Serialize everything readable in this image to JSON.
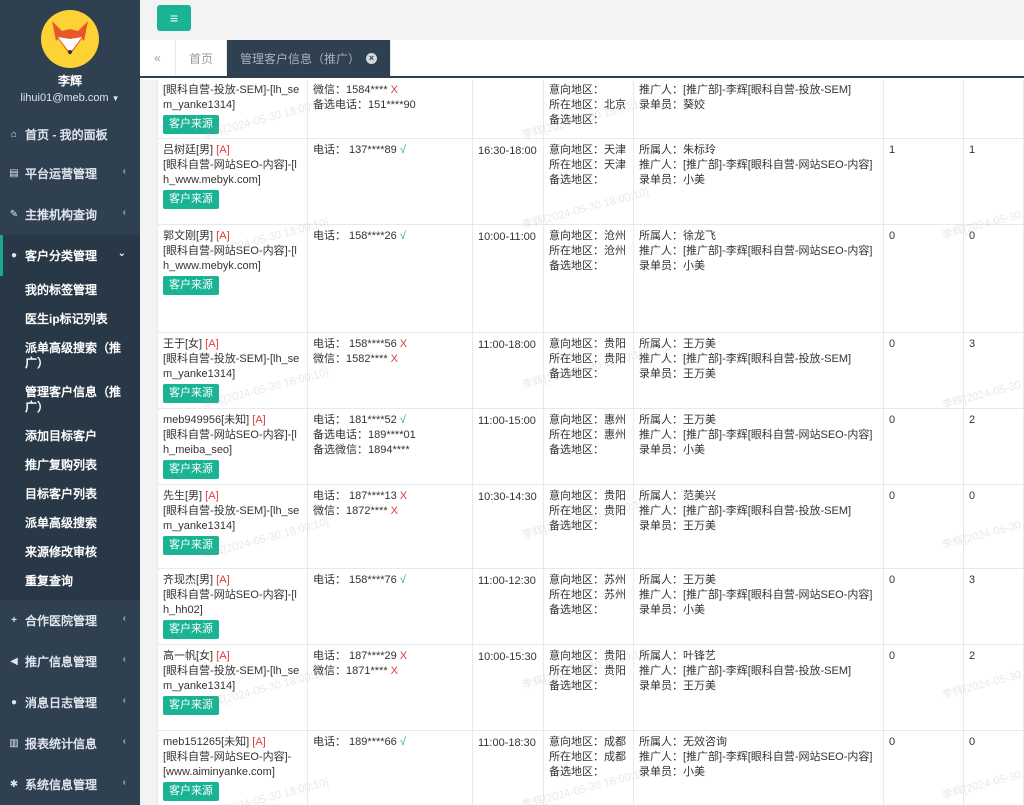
{
  "user": {
    "name": "李辉",
    "email": "lihui01@meb.com"
  },
  "nav": {
    "home": "首页 - 我的面板",
    "platform": "平台运营管理",
    "org": "主推机构查询",
    "customer": "客户分类管理",
    "sub": [
      "我的标签管理",
      "医生ip标记列表",
      "派单高级搜索（推广）",
      "管理客户信息（推广）",
      "添加目标客户",
      "推广复购列表",
      "目标客户列表",
      "派单高级搜索",
      "来源修改审核",
      "重复查询"
    ],
    "hospital": "合作医院管理",
    "promo": "推广信息管理",
    "msglog": "消息日志管理",
    "report": "报表统计信息",
    "system": "系统信息管理"
  },
  "tabs": {
    "home": "首页",
    "active": "管理客户信息（推广）"
  },
  "watermark_text": "李辉[2024-05-30 18:00:10]",
  "labels": {
    "source_btn": "客户来源",
    "intent": "意向地区：",
    "location": "所在地区：",
    "alt": "备选地区：",
    "owner": "所属人：",
    "promoter": "推广人：",
    "recorder": "录单员："
  },
  "rows": [
    {
      "n1": "",
      "n2": "",
      "src": "[眼科自营-投放-SEM]-[lh_sem_yanke1314]",
      "contacts": [
        [
          "微信：1584****",
          "X"
        ],
        [
          "备选电话：151****90",
          ""
        ]
      ],
      "time": "",
      "intent": "",
      "loc": "北京",
      "alt": "",
      "owner": "",
      "promoter": "[推广部]-李辉[眼科自营-投放-SEM]",
      "recorder": "葵姣",
      "v1": "",
      "v2": ""
    },
    {
      "n1": "吕树廷[男]",
      "n2": " [A]",
      "src": "[眼科自营-网站SEO-内容]-[lh_www.mebyk.com]",
      "contacts": [
        [
          "电话： 137****89",
          "√"
        ]
      ],
      "time": "16:30-18:00",
      "intent": "天津",
      "loc": "天津",
      "alt": "",
      "owner": "朱标玲",
      "promoter": "[推广部]-李辉[眼科自营-网站SEO-内容]",
      "recorder": "小美",
      "v1": "1",
      "v2": "1"
    },
    {
      "n1": "郭文刚[男]",
      "n2": " [A]",
      "src": "[眼科自营-网站SEO-内容]-[lh_www.mebyk.com]",
      "contacts": [
        [
          "电话： 158****26",
          "√"
        ]
      ],
      "time": "10:00-11:00",
      "intent": "沧州",
      "loc": "沧州",
      "alt": "",
      "owner": "徐龙飞",
      "promoter": "[推广部]-李辉[眼科自营-网站SEO-内容]",
      "recorder": "小美",
      "v1": "0",
      "v2": "0"
    },
    {
      "n1": "王于[女]",
      "n2": " [A]",
      "src": "[眼科自营-投放-SEM]-[lh_sem_yanke1314]",
      "contacts": [
        [
          "电话： 158****56",
          "X"
        ],
        [
          "微信：1582****",
          "X"
        ]
      ],
      "time": "11:00-18:00",
      "intent": "贵阳",
      "loc": "贵阳",
      "alt": "",
      "owner": "王万美",
      "promoter": "[推广部]-李辉[眼科自营-投放-SEM]",
      "recorder": "王万美",
      "v1": "0",
      "v2": "3"
    },
    {
      "n1": "meb949956[未知]",
      "n2": " [A]",
      "src": "[眼科自营-网站SEO-内容]-[lh_meiba_seo]",
      "contacts": [
        [
          "电话： 181****52",
          "√"
        ],
        [
          "备选电话：189****01",
          ""
        ],
        [
          "备选微信：1894****",
          ""
        ]
      ],
      "time": "11:00-15:00",
      "intent": "惠州",
      "loc": "惠州",
      "alt": "",
      "owner": "王万美",
      "promoter": "[推广部]-李辉[眼科自营-网站SEO-内容]",
      "recorder": "小美",
      "v1": "0",
      "v2": "2"
    },
    {
      "n1": "先生[男]",
      "n2": " [A]",
      "src": "[眼科自营-投放-SEM]-[lh_sem_yanke1314]",
      "contacts": [
        [
          "电话： 187****13",
          "X"
        ],
        [
          "微信：1872****",
          "X"
        ]
      ],
      "time": "10:30-14:30",
      "intent": "贵阳",
      "loc": "贵阳",
      "alt": "",
      "owner": "范美兴",
      "promoter": "[推广部]-李辉[眼科自营-投放-SEM]",
      "recorder": "王万美",
      "v1": "0",
      "v2": "0"
    },
    {
      "n1": "齐现杰[男]",
      "n2": " [A]",
      "src": "[眼科自营-网站SEO-内容]-[lh_hh02]",
      "contacts": [
        [
          "电话： 158****76",
          "√"
        ]
      ],
      "time": "11:00-12:30",
      "intent": "苏州",
      "loc": "苏州",
      "alt": "",
      "owner": "王万美",
      "promoter": "[推广部]-李辉[眼科自营-网站SEO-内容]",
      "recorder": "小美",
      "v1": "0",
      "v2": "3"
    },
    {
      "n1": "高一帆[女]",
      "n2": " [A]",
      "src": "[眼科自营-投放-SEM]-[lh_sem_yanke1314]",
      "contacts": [
        [
          "电话： 187****29",
          "X"
        ],
        [
          "微信：1871****",
          "X"
        ]
      ],
      "time": "10:00-15:30",
      "intent": "贵阳",
      "loc": "贵阳",
      "alt": "",
      "owner": "叶锋艺",
      "promoter": "[推广部]-李辉[眼科自营-投放-SEM]",
      "recorder": "王万美",
      "v1": "0",
      "v2": "2"
    },
    {
      "n1": "meb151265[未知]",
      "n2": " [A]",
      "src": "[眼科自营-网站SEO-内容]-[www.aiminyanke.com]",
      "contacts": [
        [
          "电话： 189****66",
          "√"
        ]
      ],
      "time": "11:00-18:30",
      "intent": "成都",
      "loc": "成都",
      "alt": "",
      "owner": "无效咨询",
      "promoter": "[推广部]-李辉[眼科自营-网站SEO-内容]",
      "recorder": "小美",
      "v1": "0",
      "v2": "0"
    }
  ]
}
